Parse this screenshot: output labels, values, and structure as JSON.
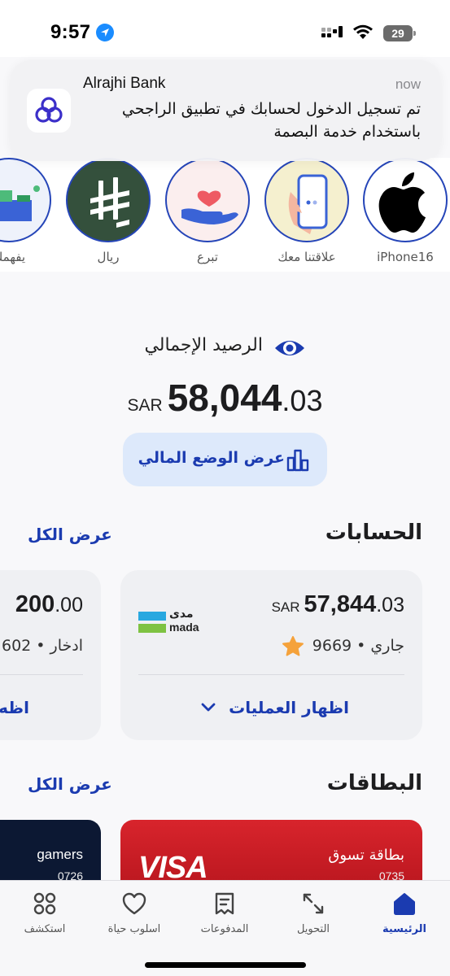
{
  "status_bar": {
    "time": "9:57",
    "battery": "29"
  },
  "notification": {
    "app": "Alrajhi Bank",
    "time": "now",
    "body": "تم تسجيل الدخول لحسابك في تطبيق الراجحي باستخدام خدمة البصمة"
  },
  "stories": [
    {
      "label": "iPhone16",
      "icon": "apple-icon"
    },
    {
      "label": "علاقتنا معك",
      "icon": "phone-hand-icon"
    },
    {
      "label": "تبرع",
      "icon": "heart-hand-icon"
    },
    {
      "label": "ريال",
      "icon": "riyal-symbol-icon"
    },
    {
      "label": "يفهمك",
      "icon": "boxes-illustration-icon"
    }
  ],
  "balance": {
    "title": "الرصيد الإجمالي",
    "currency": "SAR",
    "integer": "58,044",
    "decimal": ".03",
    "financial_button": "عرض الوضع المالي"
  },
  "accounts": {
    "title": "الحسابات",
    "view_all": "عرض الكل",
    "main": {
      "currency": "SAR",
      "integer": "57,844",
      "decimal": ".03",
      "subtitle": "جاري • 9669",
      "action": "اظهار العمليات",
      "brand": "mada",
      "brand_ar": "مدى"
    },
    "side": {
      "integer": "200",
      "decimal": ".00",
      "subtitle": "ادخار • 602",
      "action": "اظه"
    }
  },
  "cards": {
    "title": "البطاقات",
    "view_all": "عرض الكل",
    "main": {
      "name": "بطاقة تسوق",
      "number": "0735",
      "brand": "VISA"
    },
    "side": {
      "name": "gamers",
      "number": "0726"
    }
  },
  "tabbar": [
    {
      "label": "الرئيسية",
      "icon": "home-icon",
      "active": true
    },
    {
      "label": "التحويل",
      "icon": "transfer-icon",
      "active": false
    },
    {
      "label": "المدفوعات",
      "icon": "payments-icon",
      "active": false
    },
    {
      "label": "اسلوب حياة",
      "icon": "heart-icon",
      "active": false
    },
    {
      "label": "استكشف",
      "icon": "explore-grid-icon",
      "active": false
    }
  ],
  "colors": {
    "accent": "#1b3bb0",
    "card_red": "#d8242c",
    "ring": "#2545b8"
  }
}
